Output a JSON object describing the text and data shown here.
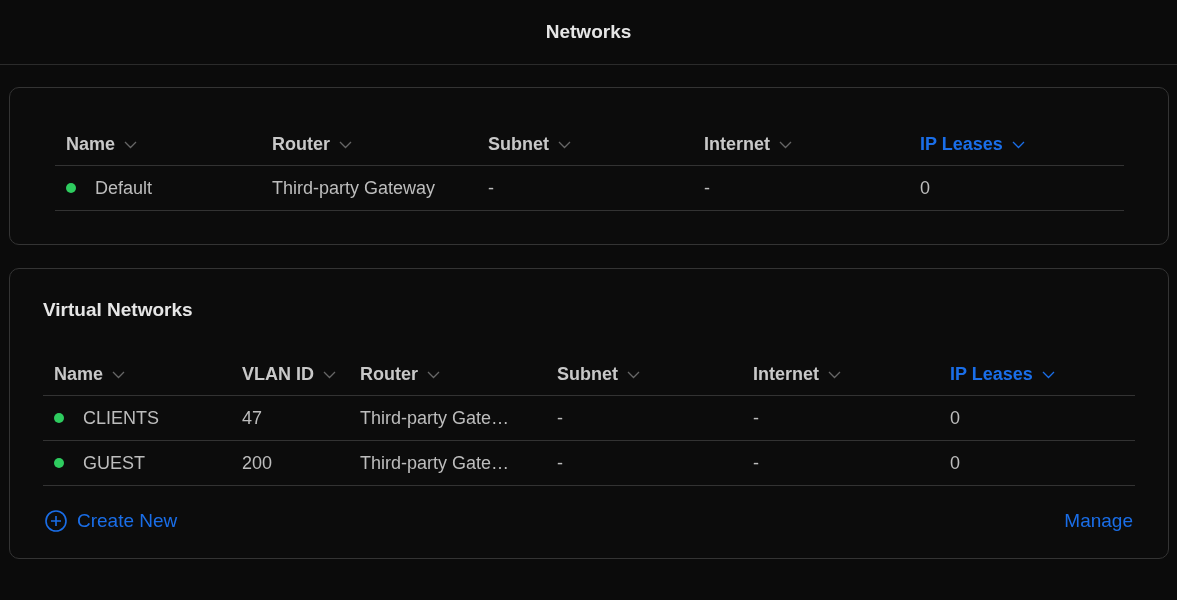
{
  "header": {
    "title": "Networks"
  },
  "networks": {
    "columns": [
      {
        "label": "Name",
        "sorted": false
      },
      {
        "label": "Router",
        "sorted": false
      },
      {
        "label": "Subnet",
        "sorted": false
      },
      {
        "label": "Internet",
        "sorted": false
      },
      {
        "label": "IP Leases",
        "sorted": true
      }
    ],
    "rows": [
      {
        "color": "#2ecc5f",
        "cells": [
          "Default",
          "Third-party Gateway",
          "-",
          "-",
          "0"
        ]
      }
    ]
  },
  "virtual_networks": {
    "title": "Virtual Networks",
    "columns": [
      {
        "label": "Name",
        "sorted": false
      },
      {
        "label": "VLAN ID",
        "sorted": false
      },
      {
        "label": "Router",
        "sorted": false
      },
      {
        "label": "Subnet",
        "sorted": false
      },
      {
        "label": "Internet",
        "sorted": false
      },
      {
        "label": "IP Leases",
        "sorted": true
      }
    ],
    "rows": [
      {
        "color": "#2ecc5f",
        "cells": [
          "CLIENTS",
          "47",
          "Third-party Gate…",
          "-",
          "-",
          "0"
        ]
      },
      {
        "color": "#2ecc5f",
        "cells": [
          "GUEST",
          "200",
          "Third-party Gate…",
          "-",
          "-",
          "0"
        ]
      }
    ],
    "create_link": "Create New",
    "manage_link": "Manage"
  }
}
